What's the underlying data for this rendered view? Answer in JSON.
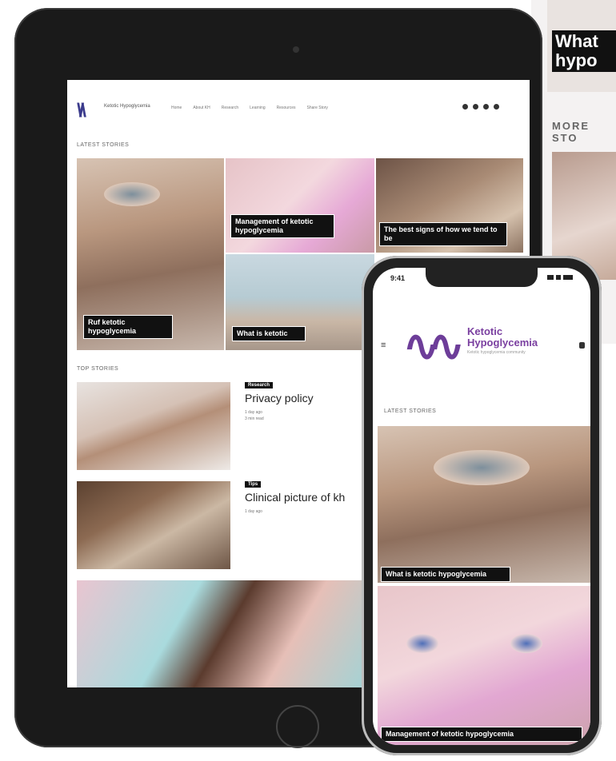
{
  "background_page": {
    "hero_text": "What\nhypo",
    "more_stories": "MORE STO"
  },
  "tablet": {
    "logo_text": "Ketotic Hypoglycemia",
    "nav": [
      "Home",
      "About KH",
      "Research",
      "Learning",
      "Resources",
      "Share Story"
    ],
    "latest_section": "Latest stories",
    "hero_tiles": [
      {
        "caption": "Ruf ketotic hypoglycemia"
      },
      {
        "caption": "Management of ketotic hypoglycemia"
      },
      {
        "caption": "The best signs of how we tend to be"
      },
      {
        "caption": "What is ketotic"
      }
    ],
    "top_section": "Top stories",
    "articles": [
      {
        "tag": "Research",
        "title": "Privacy policy",
        "meta1": "1 day ago",
        "meta2": "3 min read"
      },
      {
        "tag": "Tips",
        "title": "Clinical picture of kh",
        "meta1": "1 day ago",
        "meta2": ""
      }
    ]
  },
  "phone": {
    "time": "9:41",
    "logo_text": "Ketotic Hypoglycemia",
    "logo_sub": "Ketotic hypoglycemia community",
    "menu_icon": "menu-icon",
    "latest_section": "Latest stories",
    "tile_caption": "What is ketotic hypoglycemia",
    "bottom_caption": "Management of ketotic hypoglycemia"
  },
  "colors": {
    "brand_purple": "#6d3d99",
    "brand_blue": "#3b3b8c",
    "caption_bg": "#111111"
  }
}
